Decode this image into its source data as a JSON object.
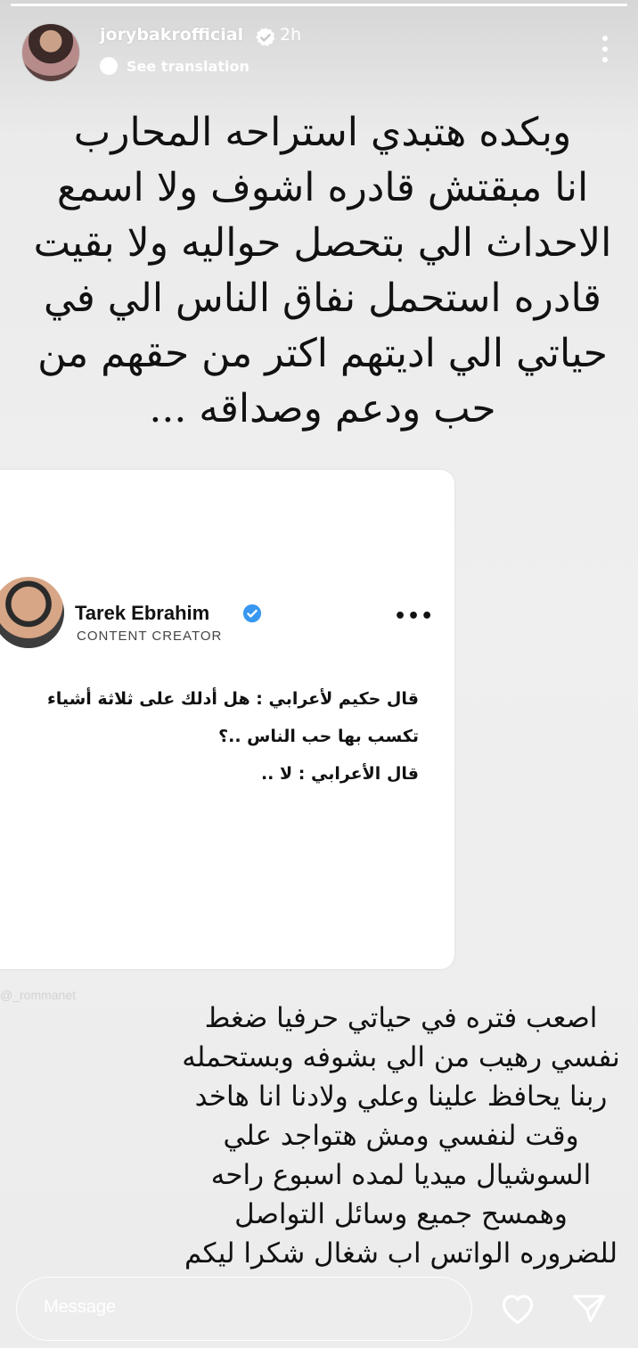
{
  "header": {
    "username": "jorybakrofficial",
    "time": "2h",
    "translate": "See translation"
  },
  "story": {
    "main_lines": [
      "وبكده هتبدي استراحه المحارب",
      "انا مبقتش قادره اشوف ولا اسمع",
      "الاحداث الي بتحصل حواليه ولا بقيت",
      "قادره استحمل نفاق الناس الي في",
      "حياتي الي اديتهم اكتر من حقهم من",
      "حب ودعم وصداقه ..."
    ],
    "card": {
      "name": "Tarek Ebrahim",
      "role": "CONTENT CREATOR",
      "more": "•••",
      "lines": [
        "قال حكيم لأعرابي : هل أدلك على ثلاثة أشياء",
        "تكسب بها حب الناس ..؟",
        "قال الأعرابي : لا .."
      ]
    },
    "watermark": "@_rommanet",
    "lower_lines": [
      "اصعب فتره في حياتي حرفيا ضغط",
      "نفسي رهيب من الي بشوفه وبستحمله",
      "ربنا يحافظ علينا وعلي ولادنا انا هاخد",
      "وقت لنفسي ومش هتواجد علي",
      "السوشيال ميديا لمده اسبوع راحه",
      "وهمسح جميع وسائل التواصل",
      "للضروره الواتس اب شغال شكرا ليكم"
    ]
  },
  "footer": {
    "message_placeholder": "Message"
  },
  "icons": {
    "verified": "verified-badge-icon",
    "globe": "translate-icon",
    "more": "more-options-icon",
    "heart": "heart-icon",
    "send": "send-icon"
  },
  "colors": {
    "verified_blue": "#3897f0",
    "text": "#111111"
  }
}
